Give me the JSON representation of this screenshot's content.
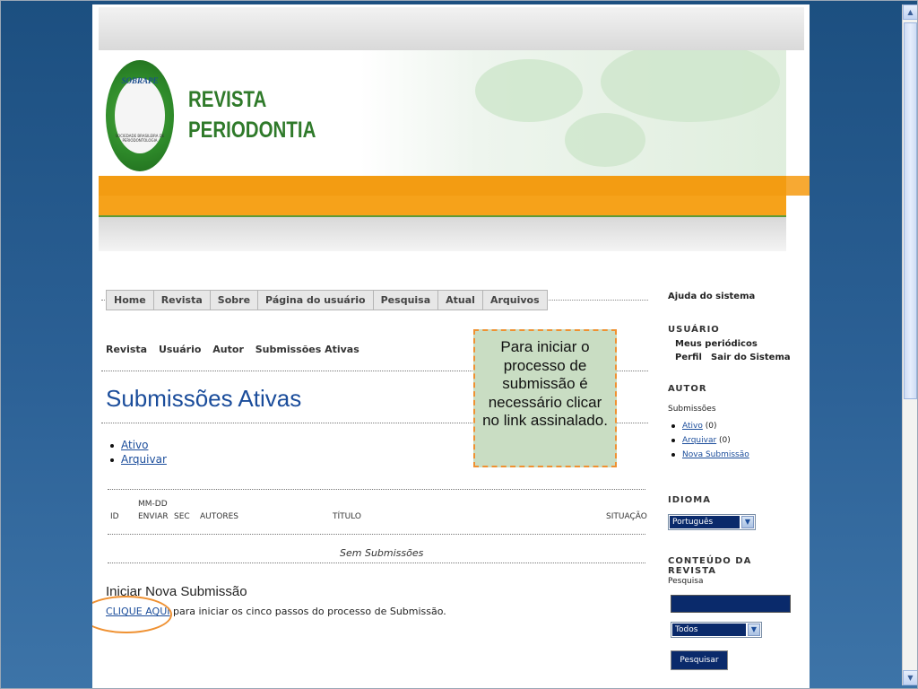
{
  "header": {
    "logo_text": "SOBRAPE",
    "logo_sub": "SOCIEDADE BRASILEIRA DE PERIODONTOLOGIA",
    "title_line1": "REVISTA",
    "title_line2": "PERIODONTIA"
  },
  "nav": [
    "Home",
    "Revista",
    "Sobre",
    "Página do usuário",
    "Pesquisa",
    "Atual",
    "Arquivos"
  ],
  "breadcrumb": [
    "Revista",
    "Usuário",
    "Autor",
    "Submissões Ativas"
  ],
  "page_title": "Submissões Ativas",
  "links": [
    "Ativo",
    "Arquivar"
  ],
  "table": {
    "headers": {
      "id": "ID",
      "date_top": "MM-DD",
      "date_bottom": "ENVIAR",
      "sec": "SEC",
      "authors": "AUTORES",
      "title": "TÍTULO",
      "status": "SITUAÇÃO"
    },
    "empty": "Sem Submissões"
  },
  "new_submission": {
    "heading": "Iniciar Nova Submissão",
    "link": "CLIQUE AQUI",
    "text": "para iniciar os cinco passos do processo de Submissão."
  },
  "callout": "Para iniciar o processo de submissão é necessário clicar no link assinalado.",
  "sidebar": {
    "help": "Ajuda do sistema",
    "user_label": "USUÁRIO",
    "my_journals": "Meus periódicos",
    "profile": "Perfil",
    "logout": "Sair do Sistema",
    "author_label": "AUTOR",
    "submissions": "Submissões",
    "active": "Ativo",
    "active_count": "(0)",
    "archive": "Arquivar",
    "archive_count": "(0)",
    "new_submission": "Nova Submissão",
    "language_label": "IDIOMA",
    "language_value": "Português (Brasil)",
    "content_label": "CONTEÚDO DA REVISTA",
    "search_label": "Pesquisa",
    "scope_value": "Todos",
    "search_button": "Pesquisar"
  },
  "colors": {
    "brand_green": "#2f7a2a",
    "orange": "#f39c12",
    "link_blue": "#1b4d9b",
    "callout_bg": "#c9ddc3"
  }
}
